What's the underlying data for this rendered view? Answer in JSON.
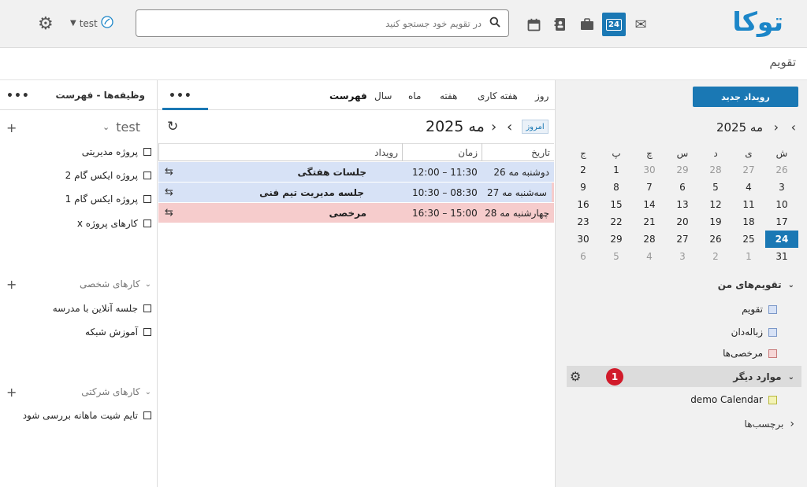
{
  "app": {
    "logo_text": "توکا",
    "page_title": "تقویم"
  },
  "header": {
    "search_placeholder": "در تقویم خود جستجو کنید",
    "user_name": "test",
    "icons": [
      "mail-icon",
      "calendar-app-icon",
      "briefcase-icon",
      "contacts-icon",
      "calendar-outline-icon"
    ],
    "active_icon_day": "24"
  },
  "sidebar": {
    "new_event_label": "رویداد جدید",
    "mini_calendar": {
      "title": "مه 2025",
      "weekdays": [
        "ش",
        "ی",
        "د",
        "س",
        "چ",
        "پ",
        "ج"
      ],
      "weeks": [
        [
          "26",
          "27",
          "28",
          "29",
          "30",
          "1",
          "2"
        ],
        [
          "3",
          "4",
          "5",
          "6",
          "7",
          "8",
          "9"
        ],
        [
          "10",
          "11",
          "12",
          "13",
          "14",
          "15",
          "16"
        ],
        [
          "17",
          "18",
          "19",
          "20",
          "21",
          "22",
          "23"
        ],
        [
          "24",
          "25",
          "26",
          "27",
          "28",
          "29",
          "30"
        ],
        [
          "31",
          "1",
          "2",
          "3",
          "4",
          "5",
          "6"
        ]
      ],
      "today": "24"
    },
    "my_calendars_label": "تقویم‌های من",
    "my_calendars": [
      {
        "label": "تقویم",
        "color": "blue"
      },
      {
        "label": "زباله‌دان",
        "color": "blue"
      },
      {
        "label": "مرخصی‌ها",
        "color": "red"
      }
    ],
    "other_label": "موارد دیگر",
    "other_badge": "1",
    "other_calendars": [
      {
        "label": "demo Calendar",
        "color": "yellow"
      }
    ],
    "tags_label": "برچسب‌ها"
  },
  "main": {
    "tabs": [
      "روز",
      "هفته کاری",
      "هفته",
      "ماه",
      "سال",
      "فهرست"
    ],
    "active_tab": "فهرست",
    "today_label": "امروز",
    "title": "مه 2025",
    "columns": {
      "date": "تاریخ",
      "time": "زمان",
      "event": "رویداد"
    },
    "events": [
      {
        "date": "دوشنبه مه 26",
        "time": "11:30 – 12:00",
        "title": "جلسات هفتگی",
        "color": "blue"
      },
      {
        "date": "سه‌شنبه مه 27",
        "time": "08:30 – 10:30",
        "title": "جلسه مدیریت تیم فنی",
        "color": "blue"
      },
      {
        "date": "چهارشنبه مه 28",
        "time": "15:00 – 16:30",
        "title": "مرخصی",
        "color": "red"
      }
    ]
  },
  "tasks": {
    "header_label": "وظیفه‌ها - فهرست",
    "list_name": "test",
    "items_main": [
      "پروژه مدیریتی",
      "پروژه ایکس گام 2",
      "پروژه ایکس گام 1",
      "کارهای پروژه x"
    ],
    "group_personal": "کارهای شخصی",
    "items_personal": [
      "جلسه آنلاین با مدرسه",
      "آموزش شبکه"
    ],
    "group_company": "کارهای شرکتی",
    "items_company": [
      "تایم شیت ماهانه بررسی شود"
    ]
  }
}
